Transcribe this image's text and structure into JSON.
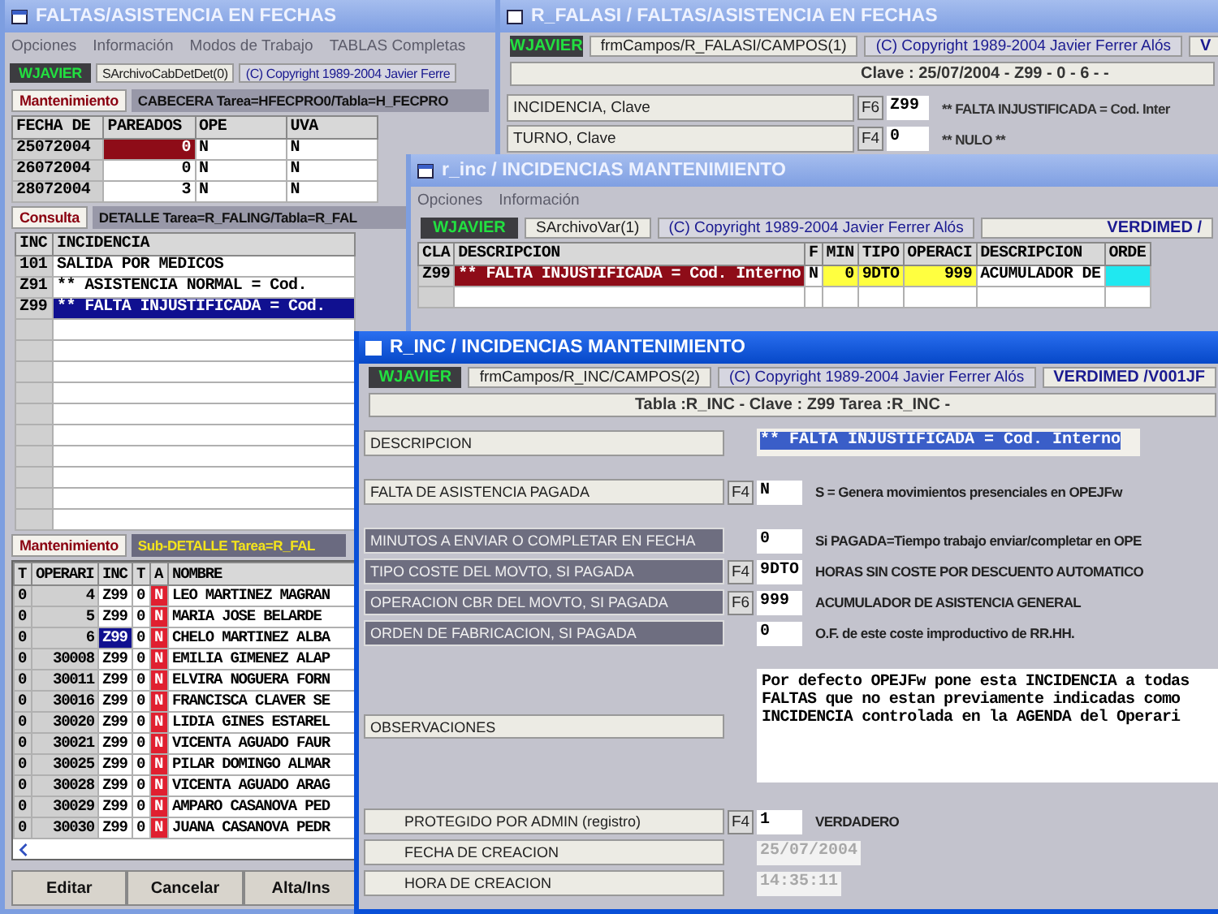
{
  "main_window": {
    "title": "FALTAS/ASISTENCIA EN FECHAS",
    "menu": [
      "Opciones",
      "Información",
      "Modos de Trabajo",
      "TABLAS Completas"
    ],
    "status": [
      "WJAVIER",
      "SArchivoCabDetDet(0)",
      "(C) Copyright 1989-2004 Javier Ferre"
    ],
    "header": {
      "mode": "Mantenimiento",
      "caption": "CABECERA Tarea=HFECPRO0/Tabla=H_FECPRO",
      "columns": [
        "FECHA DE",
        "PAREADOS",
        "OPE",
        "UVA"
      ],
      "rows": [
        {
          "cells": [
            "25072004",
            "0",
            "N",
            "N"
          ],
          "selected": true
        },
        {
          "cells": [
            "26072004",
            "0",
            "N",
            "N"
          ],
          "selected": false
        },
        {
          "cells": [
            "28072004",
            "3",
            "N",
            "N"
          ],
          "selected": false
        }
      ]
    },
    "detail": {
      "mode": "Consulta",
      "caption": "DETALLE Tarea=R_FALING/Tabla=R_FAL",
      "columns": [
        "INC",
        "INCIDENCIA"
      ],
      "rows": [
        {
          "cells": [
            "101",
            "SALIDA POR MEDICOS"
          ],
          "selected": false
        },
        {
          "cells": [
            "Z91",
            "** ASISTENCIA NORMAL = Cod."
          ],
          "selected": false
        },
        {
          "cells": [
            "Z99",
            "** FALTA INJUSTIFICADA = Cod."
          ],
          "selected": true
        }
      ]
    },
    "subdetail": {
      "mode": "Mantenimiento",
      "caption": "Sub-DETALLE Tarea=R_FAL",
      "columns": [
        "T",
        "OPERARI",
        "INC",
        "T",
        "A",
        "NOMBRE"
      ],
      "rows": [
        {
          "cells": [
            "0",
            "4",
            "Z99",
            "0",
            "N",
            "LEO MARTINEZ MAGRAN"
          ],
          "selected": false
        },
        {
          "cells": [
            "0",
            "5",
            "Z99",
            "0",
            "N",
            "MARIA JOSE BELARDE"
          ],
          "selected": false
        },
        {
          "cells": [
            "0",
            "6",
            "Z99",
            "0",
            "N",
            "CHELO MARTINEZ ALBA"
          ],
          "selected": true
        },
        {
          "cells": [
            "0",
            "30008",
            "Z99",
            "0",
            "N",
            "EMILIA GIMENEZ ALAP"
          ],
          "selected": false
        },
        {
          "cells": [
            "0",
            "30011",
            "Z99",
            "0",
            "N",
            "ELVIRA NOGUERA FORN"
          ],
          "selected": false
        },
        {
          "cells": [
            "0",
            "30016",
            "Z99",
            "0",
            "N",
            "FRANCISCA CLAVER SE"
          ],
          "selected": false
        },
        {
          "cells": [
            "0",
            "30020",
            "Z99",
            "0",
            "N",
            "LIDIA GINES ESTAREL"
          ],
          "selected": false
        },
        {
          "cells": [
            "0",
            "30021",
            "Z99",
            "0",
            "N",
            "VICENTA AGUADO FAUR"
          ],
          "selected": false
        },
        {
          "cells": [
            "0",
            "30025",
            "Z99",
            "0",
            "N",
            "PILAR DOMINGO ALMAR"
          ],
          "selected": false
        },
        {
          "cells": [
            "0",
            "30028",
            "Z99",
            "0",
            "N",
            "VICENTA AGUADO ARAG"
          ],
          "selected": false
        },
        {
          "cells": [
            "0",
            "30029",
            "Z99",
            "0",
            "N",
            "AMPARO CASANOVA PED"
          ],
          "selected": false
        },
        {
          "cells": [
            "0",
            "30030",
            "Z99",
            "0",
            "N",
            "JUANA CASANOVA PEDR"
          ],
          "selected": false
        }
      ]
    },
    "buttons": [
      "Editar",
      "Cancelar",
      "Alta/Ins"
    ]
  },
  "falasi_window": {
    "title": "R_FALASI / FALTAS/ASISTENCIA EN FECHAS",
    "status": [
      "WJAVIER",
      "frmCampos/R_FALASI/CAMPOS(1)",
      "(C) Copyright 1989-2004 Javier Ferrer Alós",
      "V"
    ],
    "key_line": "Clave : 25/07/2004 - Z99 - 0 - 6 -  -",
    "fields": [
      {
        "label": "INCIDENCIA, Clave",
        "key": "F6",
        "value": "Z99",
        "note": "** FALTA INJUSTIFICADA = Cod. Inter"
      },
      {
        "label": "TURNO, Clave",
        "key": "F4",
        "value": "0",
        "note": "** NULO **"
      }
    ]
  },
  "list_window": {
    "title": "r_inc / INCIDENCIAS MANTENIMIENTO",
    "menu": [
      "Opciones",
      "Información"
    ],
    "status": [
      "WJAVIER",
      "SArchivoVar(1)",
      "(C) Copyright 1989-2004 Javier Ferrer Alós",
      "VERDIMED /"
    ],
    "columns": [
      {
        "label": "CLA",
        "kind": "key"
      },
      {
        "label": "DESCRIPCION",
        "kind": "plain"
      },
      {
        "label": "F",
        "kind": "plain"
      },
      {
        "label": "MIN",
        "kind": "required"
      },
      {
        "label": "TIPO",
        "kind": "required"
      },
      {
        "label": "OPERACI",
        "kind": "required"
      },
      {
        "label": "DESCRIPCION",
        "kind": "plain"
      },
      {
        "label": "ORDE",
        "kind": "lookup"
      }
    ],
    "rows": [
      {
        "cells": [
          "Z99",
          "** FALTA INJUSTIFICADA = Cod. Interno",
          "N",
          "0",
          "9DTO",
          "999",
          "ACUMULADOR DE",
          ""
        ],
        "selected": true
      }
    ]
  },
  "form_window": {
    "title": "R_INC / INCIDENCIAS MANTENIMIENTO",
    "status": [
      "WJAVIER",
      "frmCampos/R_INC/CAMPOS(2)",
      "(C) Copyright 1989-2004 Javier Ferrer Alós",
      "VERDIMED /V001JF"
    ],
    "key_line": "Tabla :R_INC - Clave : Z99 Tarea :R_INC -",
    "groups": [
      [
        {
          "kind": "light",
          "label": "DESCRIPCION",
          "value": "** FALTA INJUSTIFICADA = Cod. Interno",
          "selected": true
        }
      ],
      [
        {
          "kind": "light",
          "label": "FALTA DE ASISTENCIA PAGADA",
          "key": "F4",
          "value": "N",
          "note": "S = Genera movimientos presenciales en OPEJFw"
        }
      ],
      [
        {
          "kind": "dark",
          "label": "MINUTOS A ENVIAR O COMPLETAR EN FECHA",
          "value": "0",
          "note": "Si PAGADA=Tiempo trabajo enviar/completar en OPE"
        },
        {
          "kind": "dark",
          "label": "TIPO COSTE DEL MOVTO, SI PAGADA",
          "key": "F4",
          "value": "9DTO",
          "note": "HORAS SIN COSTE POR DESCUENTO AUTOMATICO"
        },
        {
          "kind": "dark",
          "label": "OPERACION CBR DEL MOVTO, SI PAGADA",
          "key": "F6",
          "value": "999",
          "note": "ACUMULADOR DE ASISTENCIA GENERAL"
        },
        {
          "kind": "dark",
          "label": "ORDEN DE FABRICACION, SI PAGADA",
          "value": "0",
          "note": "O.F. de este coste improductivo de RR.HH."
        }
      ],
      [
        {
          "kind": "memo",
          "label": "OBSERVACIONES",
          "value": "Por defecto OPEJFw pone esta INCIDENCIA a todas\nFALTAS que no estan previamente indicadas como\nINCIDENCIA controlada en la AGENDA del Operari"
        }
      ],
      [
        {
          "kind": "indented",
          "label": "PROTEGIDO POR ADMIN (registro)",
          "key": "F4",
          "value": "1",
          "note": "VERDADERO"
        },
        {
          "kind": "indented",
          "label": "FECHA DE CREACION",
          "value": "25/07/2004",
          "disabled": true
        },
        {
          "kind": "indented",
          "label": "HORA DE CREACION",
          "value": "14:35:11",
          "disabled": true
        }
      ]
    ]
  }
}
